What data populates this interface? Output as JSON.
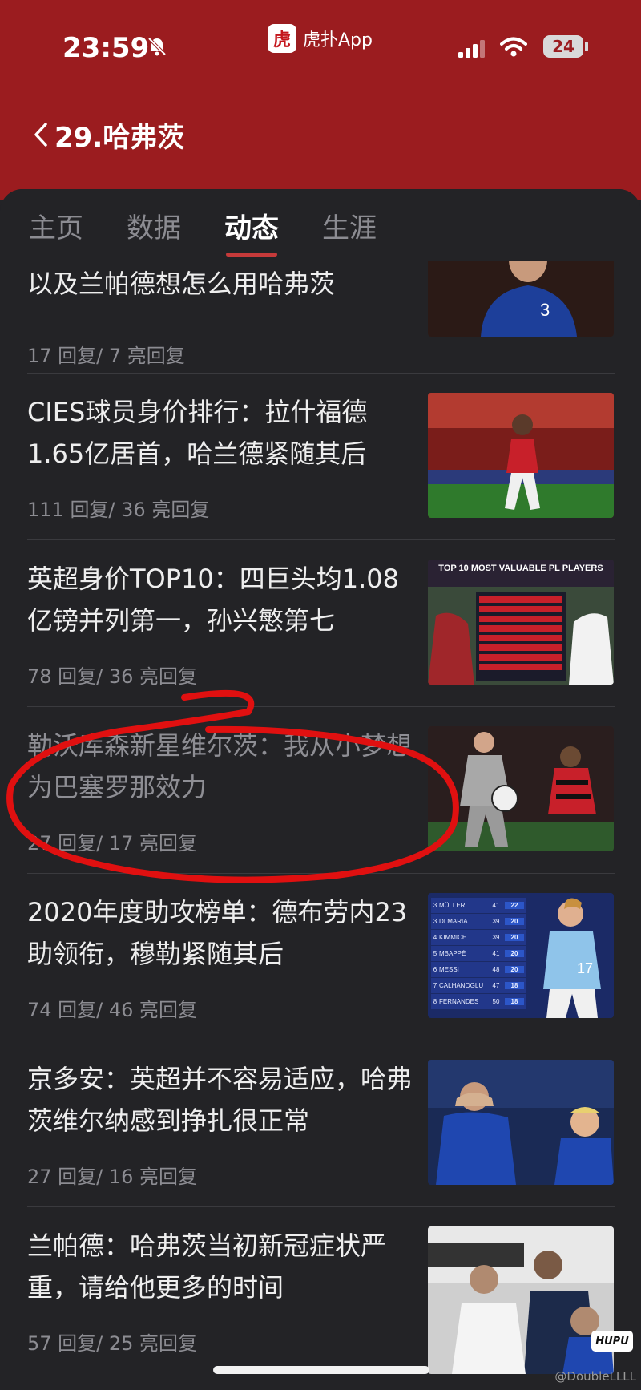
{
  "status_bar": {
    "time": "23:59",
    "battery": "24",
    "app_name": "虎扑App",
    "app_logo_char": "虎"
  },
  "nav": {
    "title": "29.哈弗茨"
  },
  "tabs": [
    {
      "label": "主页",
      "active": false
    },
    {
      "label": "数据",
      "active": false
    },
    {
      "label": "动态",
      "active": true
    },
    {
      "label": "生涯",
      "active": false
    }
  ],
  "feed": [
    {
      "title": "博斯：疑惑曼联为啥买范德贝克，以及兰帕德想怎么用哈弗茨",
      "meta": "17  回复/ 7 亮回复"
    },
    {
      "title": "CIES球员身价排行：拉什福德1.65亿居首，哈兰德紧随其后",
      "meta": "111  回复/ 36 亮回复"
    },
    {
      "title": "英超身价TOP10：四巨头均1.08亿镑并列第一，孙兴慜第七",
      "meta": "78  回复/ 36 亮回复",
      "thumb_title": "TOP 10 MOST VALUABLE PL PLAYERS"
    },
    {
      "title": "勒沃库森新星维尔茨：我从小梦想为巴塞罗那效力",
      "meta": "27  回复/ 17 亮回复",
      "visited": true
    },
    {
      "title": "2020年度助攻榜单：德布劳内23助领衔，穆勒紧随其后",
      "meta": "74  回复/ 46 亮回复",
      "table": [
        {
          "rank": "3",
          "name": "MÜLLER",
          "games": "41",
          "assists": "22"
        },
        {
          "rank": "3",
          "name": "DI MARIA",
          "games": "39",
          "assists": "20"
        },
        {
          "rank": "4",
          "name": "KIMMICH",
          "games": "39",
          "assists": "20"
        },
        {
          "rank": "5",
          "name": "MBAPPÉ",
          "games": "41",
          "assists": "20"
        },
        {
          "rank": "6",
          "name": "MESSI",
          "games": "48",
          "assists": "20"
        },
        {
          "rank": "7",
          "name": "CALHANOGLU",
          "games": "47",
          "assists": "18"
        },
        {
          "rank": "8",
          "name": "FERNANDES",
          "games": "50",
          "assists": "18"
        }
      ]
    },
    {
      "title": "京多安：英超并不容易适应，哈弗茨维尔纳感到挣扎很正常",
      "meta": "27  回复/ 16 亮回复"
    },
    {
      "title": "兰帕德：哈弗茨当初新冠症状严重，请给他更多的时间",
      "meta": "57  回复/ 25 亮回复"
    }
  ],
  "watermark": "@DoubleLLLL",
  "hupu_mark": "HUPU",
  "colors": {
    "header": "#9b1c1f",
    "background": "#232326",
    "accent": "#c63a3a",
    "annotation": "#e01010"
  }
}
